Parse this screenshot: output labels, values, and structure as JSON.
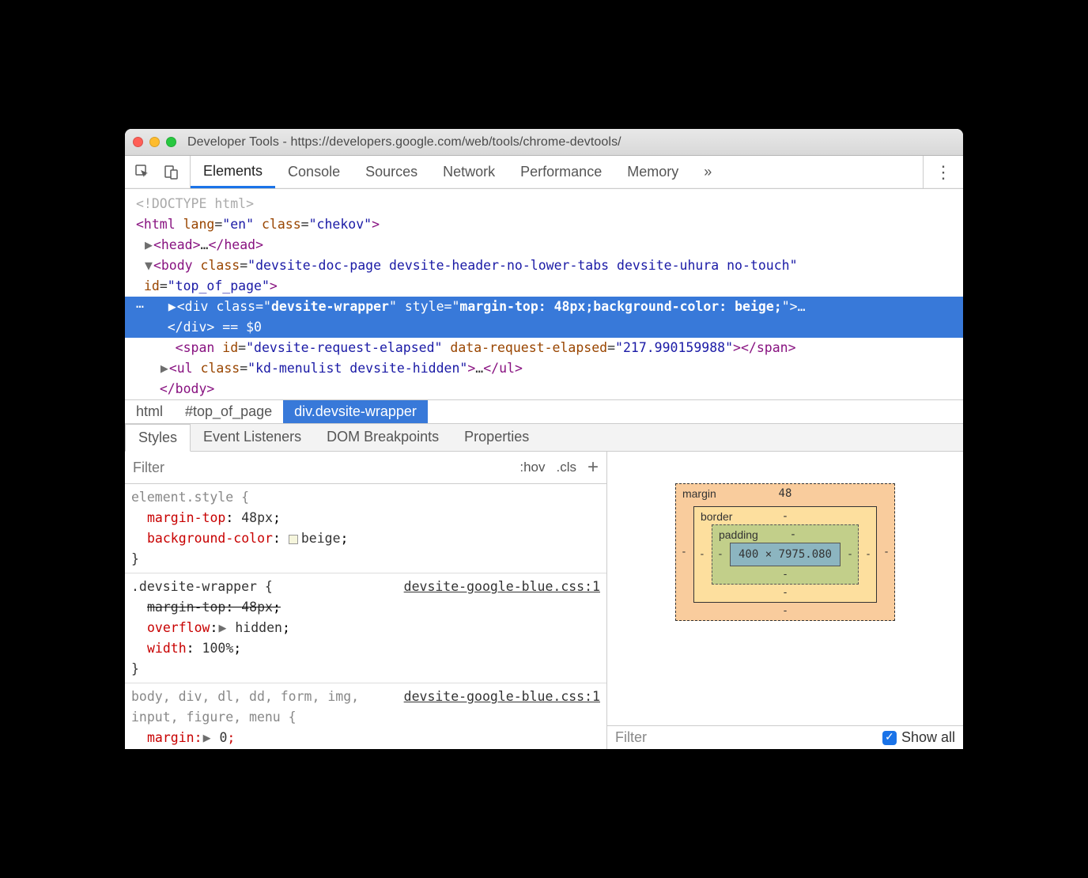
{
  "window": {
    "title": "Developer Tools - https://developers.google.com/web/tools/chrome-devtools/"
  },
  "toolbar": {
    "tabs": [
      "Elements",
      "Console",
      "Sources",
      "Network",
      "Performance",
      "Memory"
    ],
    "more": "»"
  },
  "dom": {
    "doctype": "<!DOCTYPE html>",
    "html_open": "<html lang=\"en\" class=\"chekov\">",
    "head": "<head>…</head>",
    "body_open": "<body class=\"devsite-doc-page devsite-header-no-lower-tabs devsite-uhura no-touch\" id=\"top_of_page\">",
    "selected_open": "<div class=\"devsite-wrapper\" style=\"margin-top: 48px;background-color: beige;\">…</div>",
    "selected_suffix": " == $0",
    "span_line": "<span id=\"devsite-request-elapsed\" data-request-elapsed=\"217.990159988\"></span>",
    "ul_line": "<ul class=\"kd-menulist devsite-hidden\">…</ul>",
    "body_close": "</body>"
  },
  "breadcrumb": {
    "items": [
      "html",
      "#top_of_page",
      "div.devsite-wrapper"
    ]
  },
  "styles_tabs": [
    "Styles",
    "Event Listeners",
    "DOM Breakpoints",
    "Properties"
  ],
  "filter": {
    "placeholder": "Filter",
    "hov": ":hov",
    "cls": ".cls"
  },
  "rules": {
    "element_style": {
      "selector": "element.style {",
      "props": [
        {
          "name": "margin-top",
          "value": "48px"
        },
        {
          "name": "background-color",
          "value": "beige",
          "swatch": true
        }
      ]
    },
    "devsite_wrapper": {
      "selector": ".devsite-wrapper {",
      "source": "devsite-google-blue.css:1",
      "props": [
        {
          "name": "margin-top",
          "value": "48px",
          "strike": true
        },
        {
          "name": "overflow",
          "value": "hidden",
          "arrow": true
        },
        {
          "name": "width",
          "value": "100%"
        }
      ]
    },
    "body_rule": {
      "selector": "body, div, dl, dd, form, img, input, figure, menu {",
      "source": "devsite-google-blue.css:1",
      "props": [
        {
          "name": "margin",
          "value": "0",
          "arrow": true
        }
      ]
    }
  },
  "box_model": {
    "margin_label": "margin",
    "margin_top": "48",
    "border_label": "border",
    "padding_label": "padding",
    "content": "400 × 7975.080",
    "dash": "-"
  },
  "computed": {
    "filter": "Filter",
    "showall": "Show all"
  }
}
